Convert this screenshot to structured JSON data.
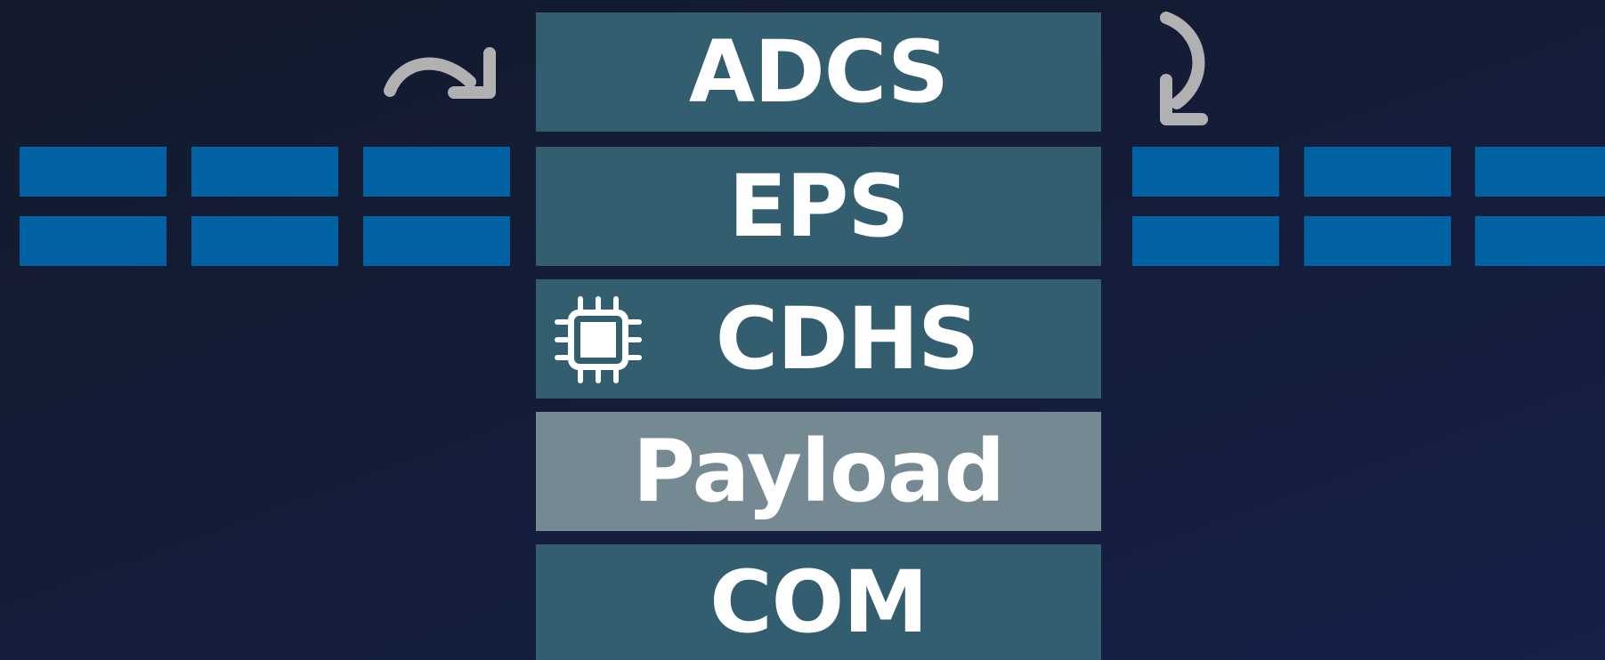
{
  "colors": {
    "module": "#335e70",
    "module_highlight": "#758992",
    "solar_panel": "#0062a3",
    "arrow": "#b1b1b3",
    "text": "#ffffff"
  },
  "modules": [
    {
      "label": "ADCS"
    },
    {
      "label": "EPS"
    },
    {
      "label": "CDHS",
      "icon": "chip-icon"
    },
    {
      "label": "Payload",
      "highlighted": true
    },
    {
      "label": "COM"
    }
  ],
  "icons": {
    "left_rotation": "rotate-right-arrow-icon",
    "right_rotation": "rotate-clockwise-arrow-icon",
    "cdhs": "chip-icon"
  }
}
